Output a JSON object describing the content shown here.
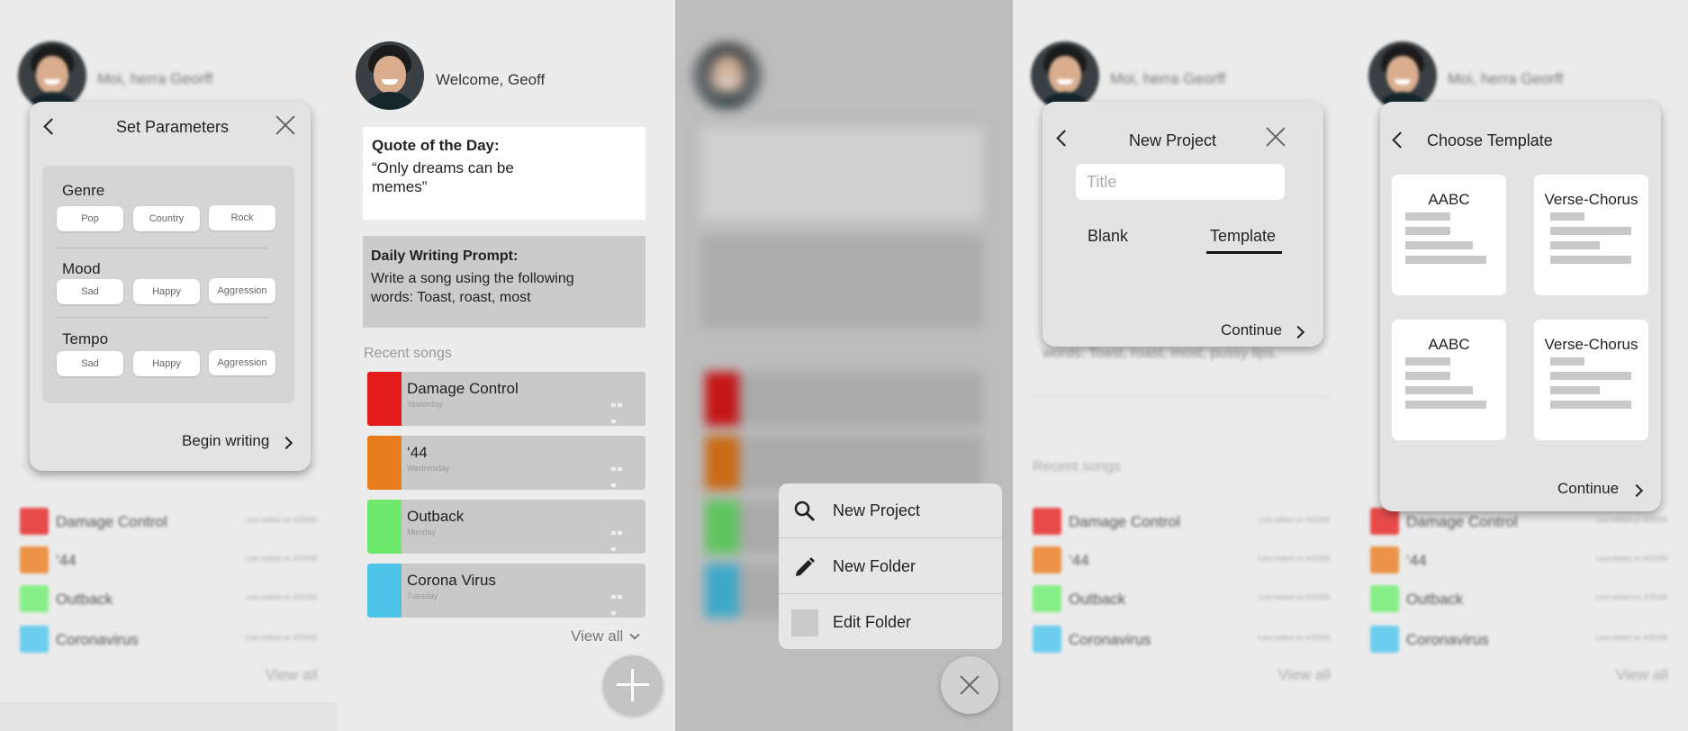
{
  "screen1": {
    "greeting": "Moi, herra Georff",
    "modal_title": "Set Parameters",
    "genre_label": "Genre",
    "genre_options": [
      "Pop",
      "Country",
      "Rock"
    ],
    "mood_label": "Mood",
    "mood_options": [
      "Sad",
      "Happy",
      "Aggression"
    ],
    "tempo_label": "Tempo",
    "tempo_options": [
      "Sad",
      "Happy",
      "Aggression"
    ],
    "begin_label": "Begin writing"
  },
  "screen2": {
    "greeting": "Welcome, Geoff",
    "quote_title": "Quote of the Day:",
    "quote_text_line1": "“Only dreams can be",
    "quote_text_line2": "memes”",
    "prompt_title": "Daily Writing Prompt:",
    "prompt_text_line1": "Write a song using the following",
    "prompt_text_line2": "words: Toast, roast, most",
    "recent_label": "Recent songs",
    "songs": [
      {
        "name": "Damage Control",
        "day": "Yesterday",
        "color": "#e31b1b"
      },
      {
        "name": "‘44",
        "day": "Wednesday",
        "color": "#e87d1e"
      },
      {
        "name": "Outback",
        "day": "Monday",
        "color": "#6ee96e"
      },
      {
        "name": "Corona Virus",
        "day": "Tuesday",
        "color": "#4dc3e8"
      }
    ],
    "view_all": "View all"
  },
  "screen3": {
    "menu": [
      {
        "label": "New Project",
        "icon": "search-icon"
      },
      {
        "label": "New Folder",
        "icon": "pencil-icon"
      },
      {
        "label": "Edit Folder",
        "icon": "folder-icon"
      }
    ]
  },
  "screen4": {
    "greeting": "Moi, herra Georff",
    "modal_title": "New Project",
    "title_placeholder": "Title",
    "tab_blank": "Blank",
    "tab_template": "Template",
    "continue_label": "Continue",
    "behind_text": "words: Toast, roast, most, pussy lips.",
    "recent_label": "Recent songs"
  },
  "screen5": {
    "greeting": "Moi, herra Georff",
    "modal_title": "Choose Template",
    "templates": [
      "AABC",
      "Verse-Chorus",
      "AABC",
      "Verse-Chorus"
    ],
    "continue_label": "Continue"
  },
  "background_list": {
    "items": [
      {
        "name": "Damage Control",
        "edited": "Last edited on 4/20/69",
        "color": "#e84a4a"
      },
      {
        "name": "‘44",
        "edited": "Last edited on 4/20/69",
        "color": "#eb9347"
      },
      {
        "name": "Outback",
        "edited": "Last edited on 4/20/69",
        "color": "#87ee87"
      },
      {
        "name": "Coronavirus",
        "edited": "Last edited on 4/20/69",
        "color": "#6ccdee"
      }
    ],
    "view_all": "View all"
  }
}
